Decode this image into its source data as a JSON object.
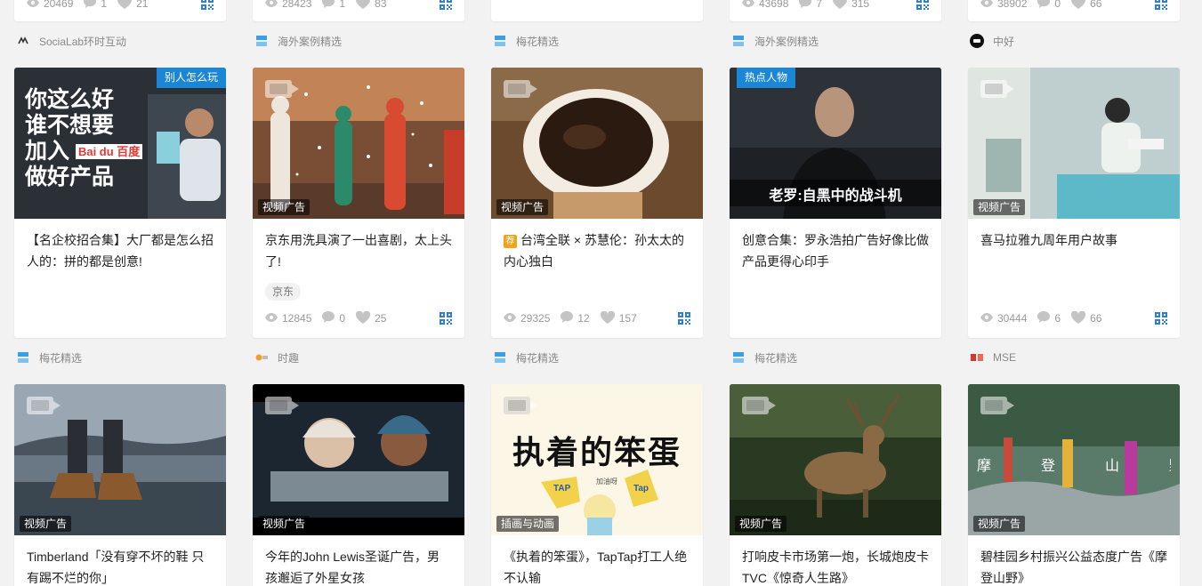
{
  "top_stats": [
    {
      "views": "20469",
      "comments": "1",
      "likes": "21"
    },
    {
      "views": "28423",
      "comments": "1",
      "likes": "83"
    },
    {
      "views": "",
      "comments": "",
      "likes": ""
    },
    {
      "views": "43698",
      "comments": "7",
      "likes": "315"
    },
    {
      "views": "38902",
      "comments": "0",
      "likes": "66"
    }
  ],
  "row1": {
    "sources": [
      "SociaLab环时互动",
      "海外案例精选",
      "梅花精选",
      "海外案例精选",
      "中好"
    ],
    "cards": [
      {
        "corner": "别人怎么玩",
        "thumb_text_lines": [
          "你这么好",
          "谁不想要",
          "加入",
          "做好产品"
        ],
        "thumb_logo": "Bai du 百度",
        "title": "【名企校招合集】大厂都是怎么招人的：拼的都是创意!"
      },
      {
        "category": "视频广告",
        "title": "京东用洗具演了一出喜剧，太上头了!",
        "tag": "京东",
        "views": "12845",
        "comments": "0",
        "likes": "25"
      },
      {
        "category": "视频广告",
        "rec": "荐",
        "title": "台湾全联 × 苏慧伦：孙太太的内心独白",
        "views": "29325",
        "comments": "12",
        "likes": "157"
      },
      {
        "corner": "热点人物",
        "subtitle": "老罗:自黑中的战斗机",
        "title": "创意合集：罗永浩拍广告好像比做产品更得心印手"
      },
      {
        "category": "视频广告",
        "title": "喜马拉雅九周年用户故事",
        "views": "30444",
        "comments": "6",
        "likes": "66"
      }
    ]
  },
  "row2": {
    "sources": [
      "梅花精选",
      "时趣",
      "梅花精选",
      "梅花精选",
      "MSE"
    ],
    "cards": [
      {
        "category": "视频广告",
        "title": "Timberland「没有穿不坏的鞋 只有踢不烂的你」"
      },
      {
        "category": "视频广告",
        "title": "今年的John Lewis圣诞广告，男孩邂逅了外星女孩"
      },
      {
        "category": "插画与动画",
        "thumb_text": "执着的笨蛋",
        "thumb_labels": [
          "TAP",
          "Tap",
          "加油呀"
        ],
        "title": "《执着的笨蛋》，TapTap打工人绝不认输"
      },
      {
        "category": "视频广告",
        "title": "打响皮卡市场第一炮，长城炮皮卡TVC《惊奇人生路》"
      },
      {
        "category": "视频广告",
        "thumb_text": "摩登山野",
        "title": "碧桂园乡村振兴公益态度广告《摩登山野》"
      }
    ]
  },
  "colors": {
    "accent": "#1c86d6",
    "rec": "#f2a31a",
    "muted": "#999999"
  }
}
